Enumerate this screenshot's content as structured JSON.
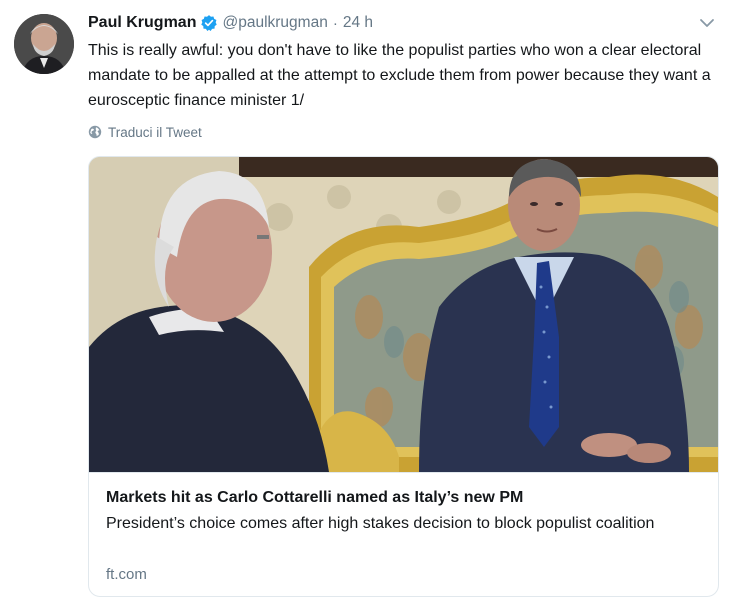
{
  "tweet": {
    "author_name": "Paul Krugman",
    "handle": "@paulkrugman",
    "separator": "·",
    "time": "24 h",
    "text": "This is really awful: you don't have to like the populist parties who won a clear electoral mandate to be appalled at the attempt to exclude them from power because they want a eurosceptic finance minister 1/",
    "translate_label": "Traduci il Tweet",
    "verified": true
  },
  "card": {
    "title": "Markets hit as Carlo Cottarelli named as Italy’s new PM",
    "description": "President’s choice comes after high stakes decision to block populist coalition",
    "domain": "ft.com"
  },
  "icons": {
    "verified": "verified-badge-icon",
    "caret": "chevron-down-icon",
    "translate": "globe-icon"
  },
  "colors": {
    "verified_blue": "#1da1f2",
    "secondary_text": "#657786",
    "primary_text": "#14171a",
    "border": "#e1e8ed"
  }
}
